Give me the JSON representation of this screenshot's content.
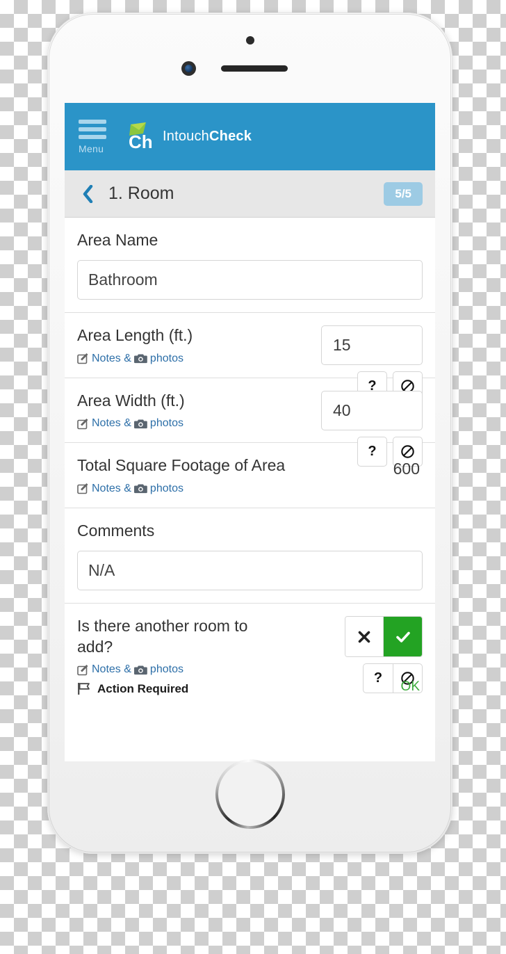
{
  "app": {
    "menu_label": "Menu",
    "brand_first": "Intouch",
    "brand_second": "Check",
    "logo_text": "Ch",
    "header_color": "#2b94c8",
    "logo_green": "#8cc63f"
  },
  "sub_header": {
    "title": "1. Room",
    "progress": "5/5",
    "back_icon": "chevron-left-icon",
    "badge_color": "#9dcbe4"
  },
  "notes_link": {
    "prefix": "Notes &",
    "suffix": "photos",
    "edit_icon": "pencil-square-icon",
    "camera_icon": "camera-icon",
    "color": "#2d6fa8"
  },
  "mini_buttons": {
    "help_label": "?",
    "na_label": "⊘",
    "help_icon": "question-mark-icon",
    "na_icon": "not-applicable-icon"
  },
  "questions": [
    {
      "id": "area-name",
      "label": "Area Name",
      "type": "text",
      "value": "Bathroom",
      "placeholder": "",
      "has_notes": false,
      "has_mini_buttons": false
    },
    {
      "id": "area-length",
      "label": "Area Length (ft.)",
      "type": "number-right",
      "value": "15",
      "placeholder": "",
      "has_notes": true,
      "has_mini_buttons": true,
      "joined_buttons": false
    },
    {
      "id": "area-width",
      "label": "Area Width (ft.)",
      "type": "number-right",
      "value": "40",
      "placeholder": "",
      "has_notes": true,
      "has_mini_buttons": true,
      "joined_buttons": false
    },
    {
      "id": "total-square-footage",
      "label": "Total Square Footage of Area",
      "type": "readonly",
      "value": "600",
      "has_notes": true,
      "has_mini_buttons": false
    },
    {
      "id": "comments",
      "label": "Comments",
      "type": "text",
      "value": "N/A",
      "placeholder": "",
      "has_notes": false,
      "has_mini_buttons": false
    },
    {
      "id": "another-room",
      "label": "Is there another room to add?",
      "type": "yesno",
      "no_icon": "cross-icon",
      "yes_icon": "check-icon",
      "selected": "yes",
      "yes_color": "#23a323",
      "has_notes": true,
      "has_mini_buttons": true,
      "joined_buttons": true,
      "flag_label": "Action Required",
      "flag_icon": "flag-icon",
      "status": "OK",
      "status_color": "#3aa93a"
    }
  ]
}
